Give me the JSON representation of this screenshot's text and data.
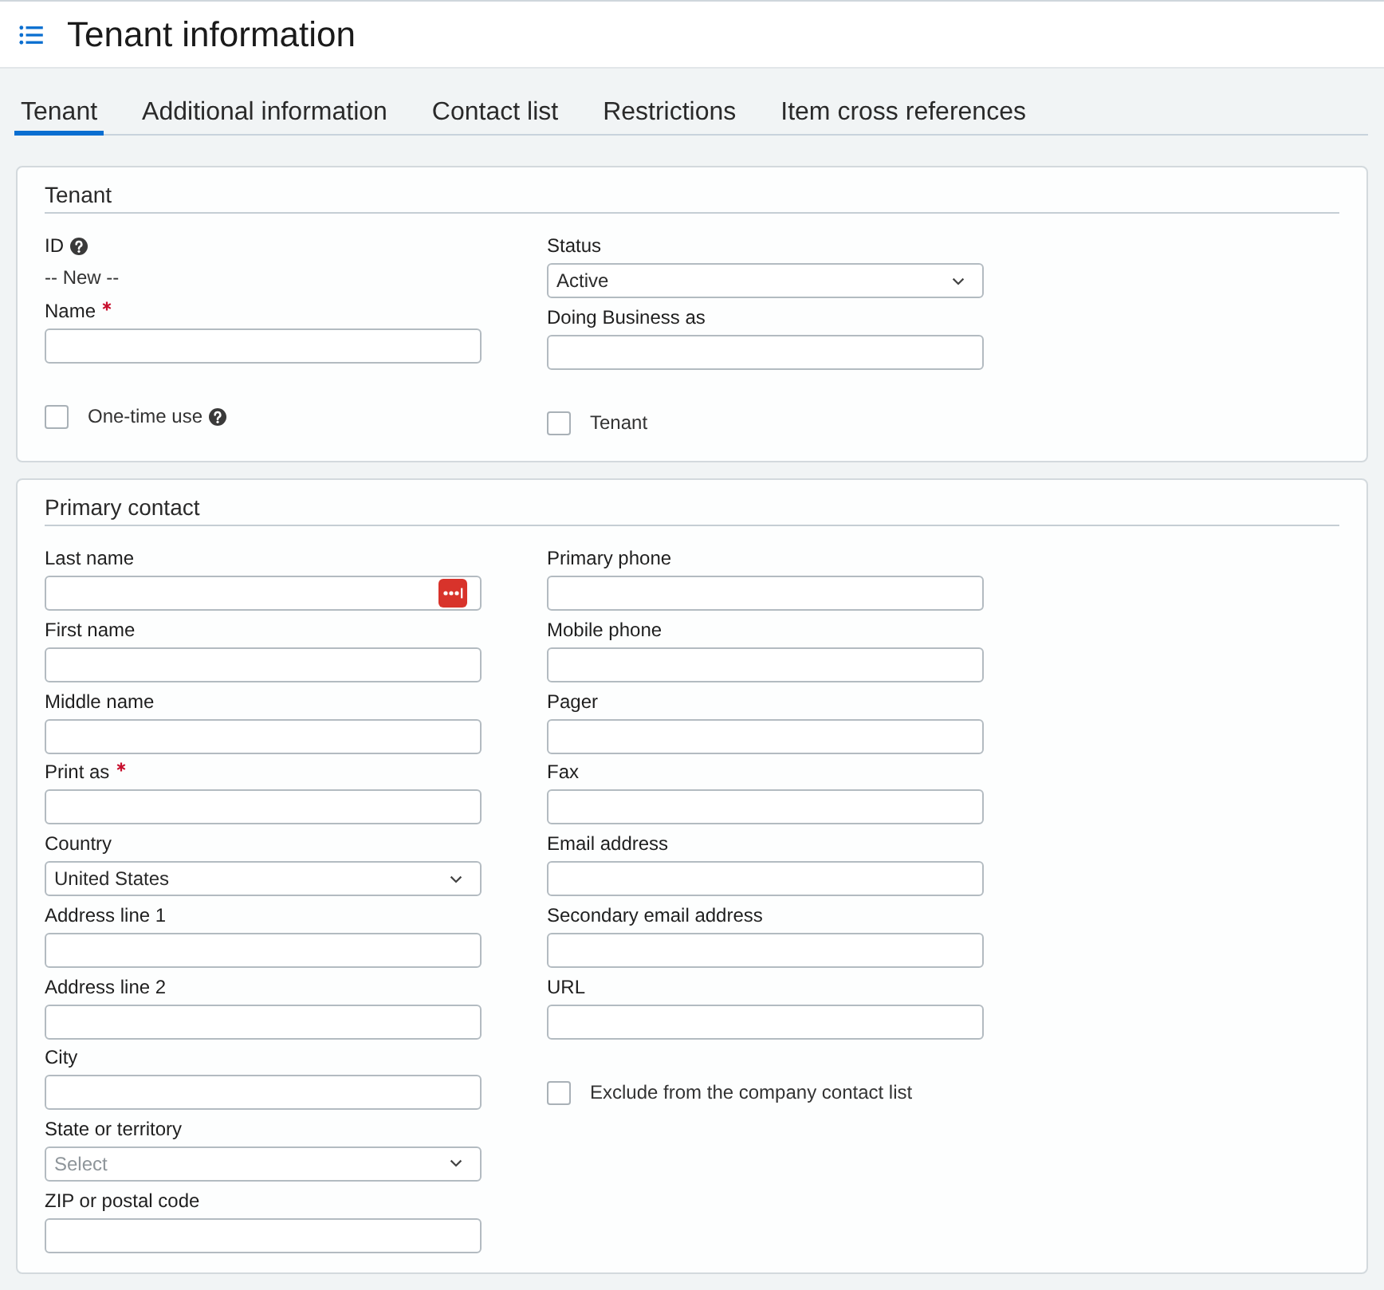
{
  "header": {
    "title": "Tenant information"
  },
  "tabs": [
    {
      "label": "Tenant",
      "selected": true
    },
    {
      "label": "Additional information",
      "selected": false
    },
    {
      "label": "Contact list",
      "selected": false
    },
    {
      "label": "Restrictions",
      "selected": false
    },
    {
      "label": "Item cross references",
      "selected": false
    }
  ],
  "sections": [
    {
      "title": "Tenant",
      "columns": [
        [
          {
            "kind": "static",
            "label": "ID",
            "help": true,
            "value": "-- New --"
          },
          {
            "kind": "text",
            "label": "Name",
            "required": true
          },
          {
            "kind": "checkbox",
            "label": "One-time use",
            "help": true,
            "checked": false
          }
        ],
        [
          {
            "kind": "select",
            "label": "Status",
            "value": "Active"
          },
          {
            "kind": "text",
            "label": "Doing Business as"
          },
          {
            "kind": "checkbox",
            "label": "Tenant",
            "checked": false
          }
        ]
      ]
    },
    {
      "title": "Primary contact",
      "columns": [
        [
          {
            "kind": "text",
            "label": "Last name",
            "lookup": true
          },
          {
            "kind": "text",
            "label": "First name"
          },
          {
            "kind": "text",
            "label": "Middle name"
          },
          {
            "kind": "text",
            "label": "Print as",
            "required": true
          },
          {
            "kind": "select",
            "label": "Country",
            "value": "United States"
          },
          {
            "kind": "text",
            "label": "Address line 1"
          },
          {
            "kind": "text",
            "label": "Address line 2"
          },
          {
            "kind": "text",
            "label": "City"
          },
          {
            "kind": "select",
            "label": "State or territory",
            "placeholder": "Select"
          },
          {
            "kind": "text",
            "label": "ZIP or postal code"
          }
        ],
        [
          {
            "kind": "text",
            "label": "Primary phone"
          },
          {
            "kind": "text",
            "label": "Mobile phone"
          },
          {
            "kind": "text",
            "label": "Pager"
          },
          {
            "kind": "text",
            "label": "Fax"
          },
          {
            "kind": "text",
            "label": "Email address"
          },
          {
            "kind": "text",
            "label": "Secondary email address"
          },
          {
            "kind": "text",
            "label": "URL"
          },
          {
            "kind": "checkbox",
            "label": "Exclude from the company contact list",
            "checked": false
          }
        ]
      ]
    }
  ]
}
